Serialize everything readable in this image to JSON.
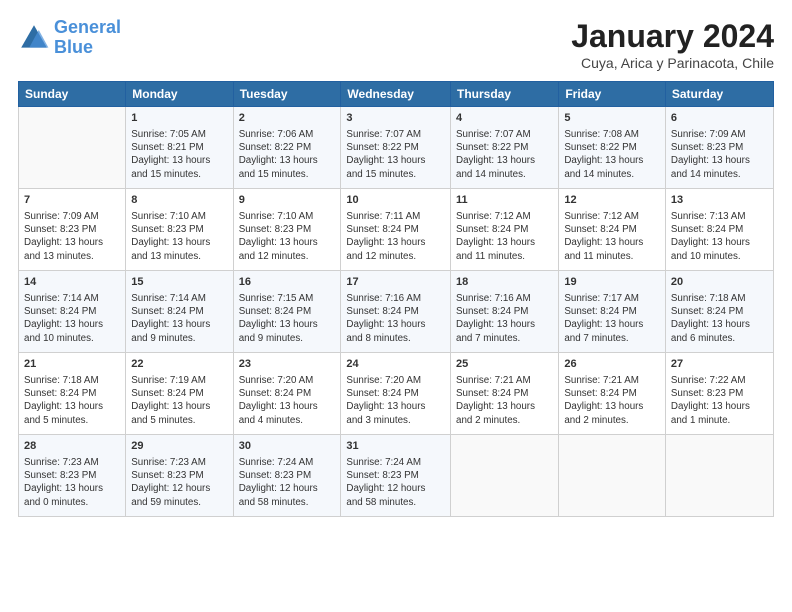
{
  "logo": {
    "line1": "General",
    "line2": "Blue"
  },
  "title": "January 2024",
  "subtitle": "Cuya, Arica y Parinacota, Chile",
  "days_header": [
    "Sunday",
    "Monday",
    "Tuesday",
    "Wednesday",
    "Thursday",
    "Friday",
    "Saturday"
  ],
  "weeks": [
    [
      {
        "day": "",
        "info": ""
      },
      {
        "day": "1",
        "info": "Sunrise: 7:05 AM\nSunset: 8:21 PM\nDaylight: 13 hours\nand 15 minutes."
      },
      {
        "day": "2",
        "info": "Sunrise: 7:06 AM\nSunset: 8:22 PM\nDaylight: 13 hours\nand 15 minutes."
      },
      {
        "day": "3",
        "info": "Sunrise: 7:07 AM\nSunset: 8:22 PM\nDaylight: 13 hours\nand 15 minutes."
      },
      {
        "day": "4",
        "info": "Sunrise: 7:07 AM\nSunset: 8:22 PM\nDaylight: 13 hours\nand 14 minutes."
      },
      {
        "day": "5",
        "info": "Sunrise: 7:08 AM\nSunset: 8:22 PM\nDaylight: 13 hours\nand 14 minutes."
      },
      {
        "day": "6",
        "info": "Sunrise: 7:09 AM\nSunset: 8:23 PM\nDaylight: 13 hours\nand 14 minutes."
      }
    ],
    [
      {
        "day": "7",
        "info": "Sunrise: 7:09 AM\nSunset: 8:23 PM\nDaylight: 13 hours\nand 13 minutes."
      },
      {
        "day": "8",
        "info": "Sunrise: 7:10 AM\nSunset: 8:23 PM\nDaylight: 13 hours\nand 13 minutes."
      },
      {
        "day": "9",
        "info": "Sunrise: 7:10 AM\nSunset: 8:23 PM\nDaylight: 13 hours\nand 12 minutes."
      },
      {
        "day": "10",
        "info": "Sunrise: 7:11 AM\nSunset: 8:24 PM\nDaylight: 13 hours\nand 12 minutes."
      },
      {
        "day": "11",
        "info": "Sunrise: 7:12 AM\nSunset: 8:24 PM\nDaylight: 13 hours\nand 11 minutes."
      },
      {
        "day": "12",
        "info": "Sunrise: 7:12 AM\nSunset: 8:24 PM\nDaylight: 13 hours\nand 11 minutes."
      },
      {
        "day": "13",
        "info": "Sunrise: 7:13 AM\nSunset: 8:24 PM\nDaylight: 13 hours\nand 10 minutes."
      }
    ],
    [
      {
        "day": "14",
        "info": "Sunrise: 7:14 AM\nSunset: 8:24 PM\nDaylight: 13 hours\nand 10 minutes."
      },
      {
        "day": "15",
        "info": "Sunrise: 7:14 AM\nSunset: 8:24 PM\nDaylight: 13 hours\nand 9 minutes."
      },
      {
        "day": "16",
        "info": "Sunrise: 7:15 AM\nSunset: 8:24 PM\nDaylight: 13 hours\nand 9 minutes."
      },
      {
        "day": "17",
        "info": "Sunrise: 7:16 AM\nSunset: 8:24 PM\nDaylight: 13 hours\nand 8 minutes."
      },
      {
        "day": "18",
        "info": "Sunrise: 7:16 AM\nSunset: 8:24 PM\nDaylight: 13 hours\nand 7 minutes."
      },
      {
        "day": "19",
        "info": "Sunrise: 7:17 AM\nSunset: 8:24 PM\nDaylight: 13 hours\nand 7 minutes."
      },
      {
        "day": "20",
        "info": "Sunrise: 7:18 AM\nSunset: 8:24 PM\nDaylight: 13 hours\nand 6 minutes."
      }
    ],
    [
      {
        "day": "21",
        "info": "Sunrise: 7:18 AM\nSunset: 8:24 PM\nDaylight: 13 hours\nand 5 minutes."
      },
      {
        "day": "22",
        "info": "Sunrise: 7:19 AM\nSunset: 8:24 PM\nDaylight: 13 hours\nand 5 minutes."
      },
      {
        "day": "23",
        "info": "Sunrise: 7:20 AM\nSunset: 8:24 PM\nDaylight: 13 hours\nand 4 minutes."
      },
      {
        "day": "24",
        "info": "Sunrise: 7:20 AM\nSunset: 8:24 PM\nDaylight: 13 hours\nand 3 minutes."
      },
      {
        "day": "25",
        "info": "Sunrise: 7:21 AM\nSunset: 8:24 PM\nDaylight: 13 hours\nand 2 minutes."
      },
      {
        "day": "26",
        "info": "Sunrise: 7:21 AM\nSunset: 8:24 PM\nDaylight: 13 hours\nand 2 minutes."
      },
      {
        "day": "27",
        "info": "Sunrise: 7:22 AM\nSunset: 8:23 PM\nDaylight: 13 hours\nand 1 minute."
      }
    ],
    [
      {
        "day": "28",
        "info": "Sunrise: 7:23 AM\nSunset: 8:23 PM\nDaylight: 13 hours\nand 0 minutes."
      },
      {
        "day": "29",
        "info": "Sunrise: 7:23 AM\nSunset: 8:23 PM\nDaylight: 12 hours\nand 59 minutes."
      },
      {
        "day": "30",
        "info": "Sunrise: 7:24 AM\nSunset: 8:23 PM\nDaylight: 12 hours\nand 58 minutes."
      },
      {
        "day": "31",
        "info": "Sunrise: 7:24 AM\nSunset: 8:23 PM\nDaylight: 12 hours\nand 58 minutes."
      },
      {
        "day": "",
        "info": ""
      },
      {
        "day": "",
        "info": ""
      },
      {
        "day": "",
        "info": ""
      }
    ]
  ]
}
